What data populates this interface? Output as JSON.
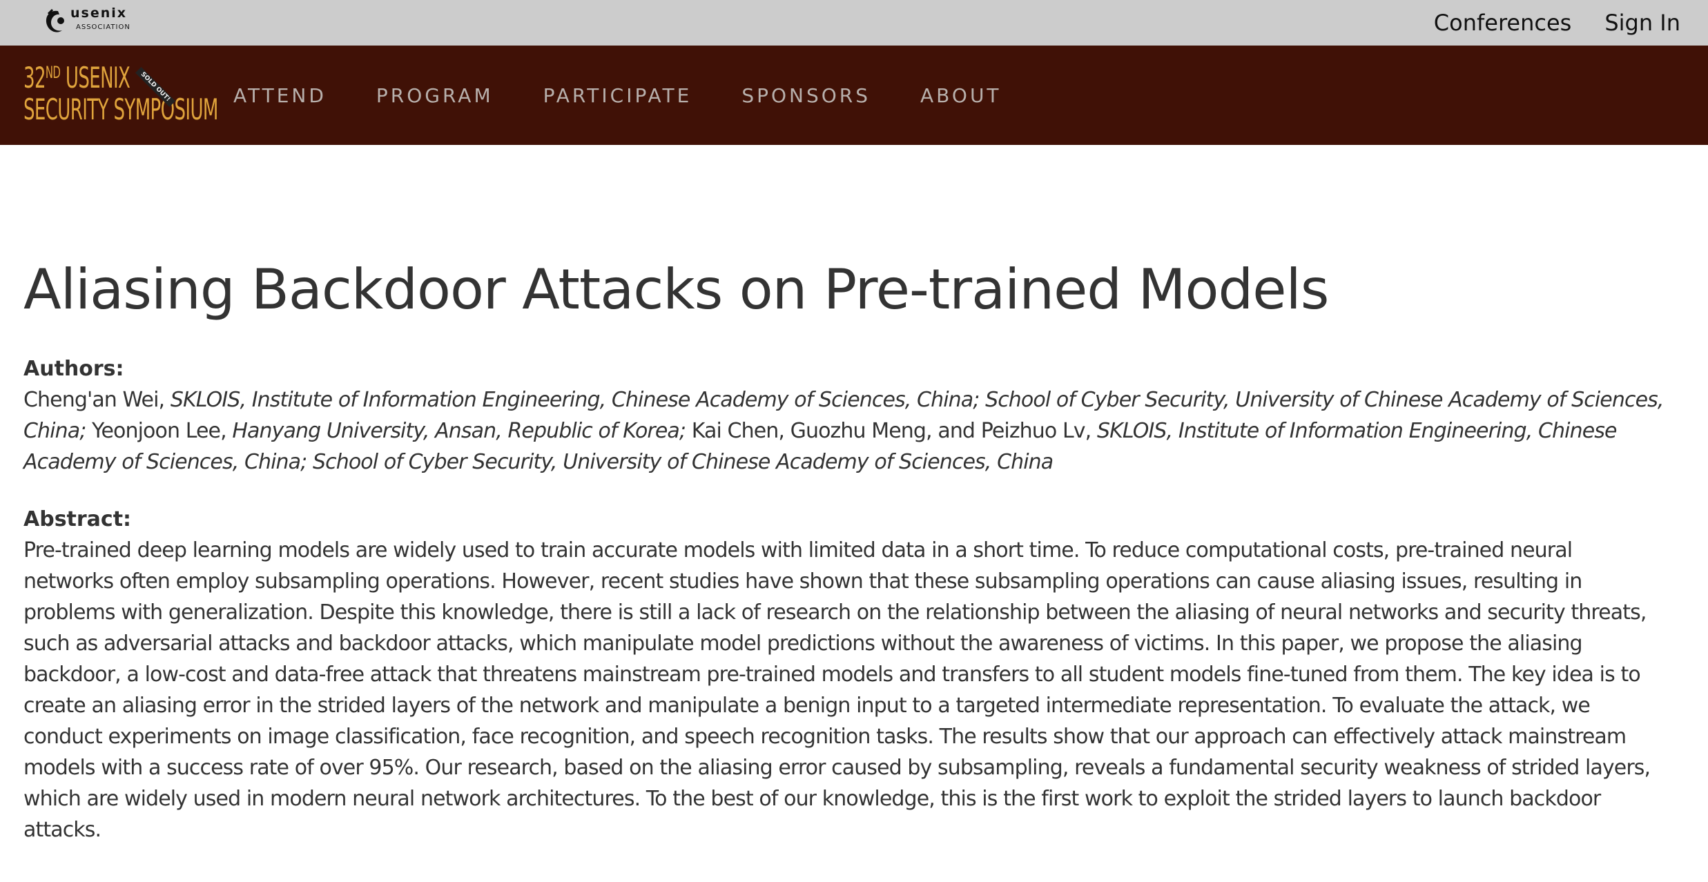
{
  "topbar": {
    "logo_word": "usenix",
    "logo_sub": "ASSOCIATION",
    "links": [
      "Conferences",
      "Sign In"
    ]
  },
  "navbar": {
    "conf_logo_line1_prefix": "32",
    "conf_logo_line1_sup": "ND",
    "conf_logo_line1_rest": " USENIX",
    "conf_logo_line2": "SECURITY SYMPOSIUM",
    "sold_out_badge": "SOLD OUT!",
    "items": [
      "ATTEND",
      "PROGRAM",
      "PARTICIPATE",
      "SPONSORS",
      "ABOUT"
    ]
  },
  "paper": {
    "title": "Aliasing Backdoor Attacks on Pre-trained Models",
    "authors_label": "Authors:",
    "authors": [
      {
        "name": "Cheng'an Wei, ",
        "affiliation": "SKLOIS, Institute of Information Engineering, Chinese Academy of Sciences, China; School of Cyber Security, University of Chinese Academy of Sciences, China;"
      },
      {
        "name": " Yeonjoon Lee, ",
        "affiliation": "Hanyang University, Ansan, Republic of Korea;"
      },
      {
        "name": " Kai Chen, Guozhu Meng, and Peizhuo Lv, ",
        "affiliation": "SKLOIS, Institute of Information Engineering, Chinese Academy of Sciences, China; School of Cyber Security, University of Chinese Academy of Sciences, China"
      }
    ],
    "abstract_label": "Abstract:",
    "abstract": "Pre-trained deep learning models are widely used to train accurate models with limited data in a short time. To reduce computational costs, pre-trained neural networks often employ subsampling operations. However, recent studies have shown that these subsampling operations can cause aliasing issues, resulting in problems with generalization. Despite this knowledge, there is still a lack of research on the relationship between the aliasing of neural networks and security threats, such as adversarial attacks and backdoor attacks, which manipulate model predictions without the awareness of victims. In this paper, we propose the aliasing backdoor, a low-cost and data-free attack that threatens mainstream pre-trained models and transfers to all student models fine-tuned from them. The key idea is to create an aliasing error in the strided layers of the network and manipulate a benign input to a targeted intermediate representation. To evaluate the attack, we conduct experiments on image classification, face recognition, and speech recognition tasks. The results show that our approach can effectively attack mainstream models with a success rate of over 95%. Our research, based on the aliasing error caused by subsampling, reveals a fundamental security weakness of strided layers, which are widely used in modern neural network architectures. To the best of our knowledge, this is the first work to exploit the strided layers to launch backdoor attacks."
  }
}
